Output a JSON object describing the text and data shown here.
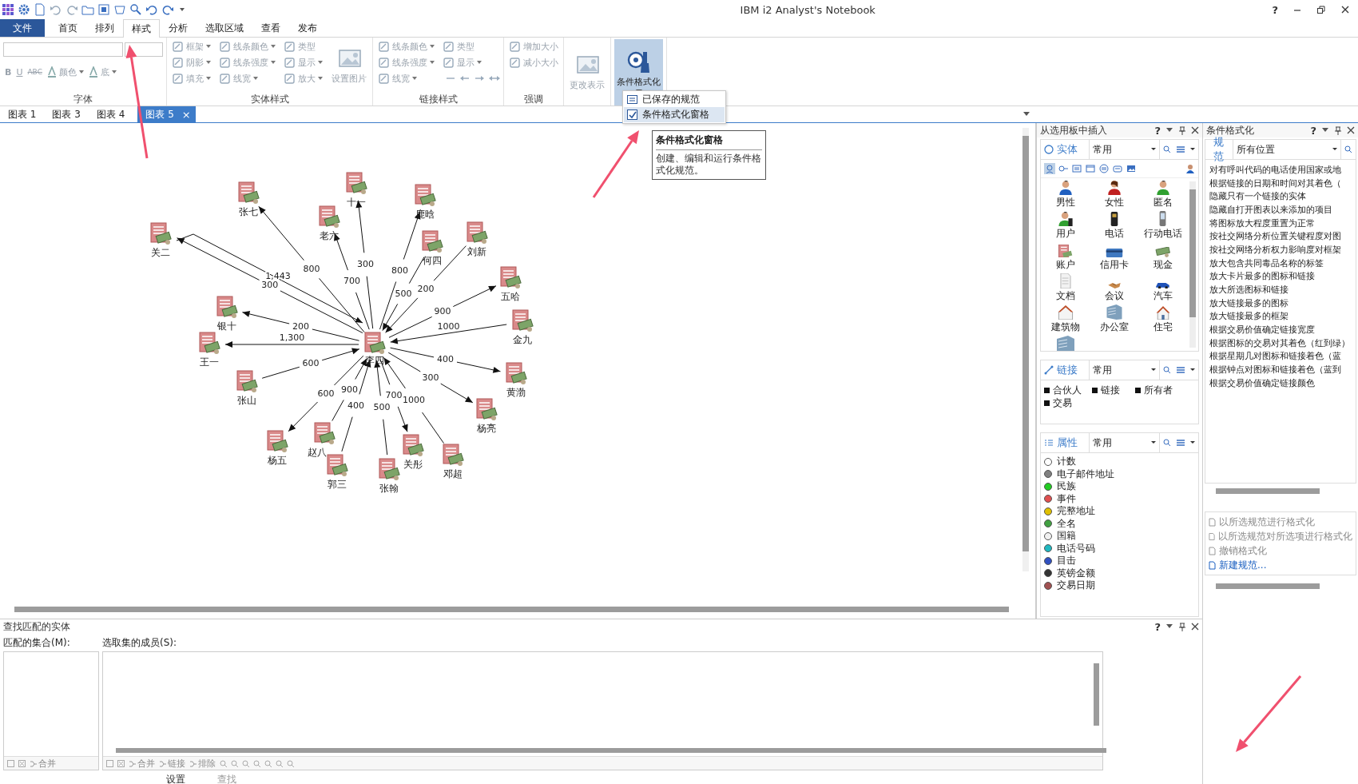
{
  "window": {
    "title": "IBM i2 Analyst's Notebook",
    "help": "?"
  },
  "ribbon_tabs": [
    {
      "label": "文件",
      "kind": "file",
      "selected": false
    },
    {
      "label": "首页",
      "kind": "tab",
      "selected": false
    },
    {
      "label": "排列",
      "kind": "tab",
      "selected": false
    },
    {
      "label": "样式",
      "kind": "tab",
      "selected": true
    },
    {
      "label": "分析",
      "kind": "tab",
      "selected": false
    },
    {
      "label": "选取区域",
      "kind": "tab",
      "selected": false
    },
    {
      "label": "查看",
      "kind": "tab",
      "selected": false
    },
    {
      "label": "发布",
      "kind": "tab",
      "selected": false
    }
  ],
  "ribbon_groups": [
    {
      "kind": "font",
      "title": "字体",
      "disabled": true,
      "items": [
        {
          "label": "B",
          "kind": "bold"
        },
        {
          "label": "U",
          "kind": "underline"
        },
        {
          "label": "ABC",
          "kind": "strike"
        },
        {
          "label": "颜色",
          "kind": "color"
        },
        {
          "label": "底",
          "kind": "color"
        }
      ]
    },
    {
      "kind": "columns",
      "title": "实体样式",
      "disabled": true,
      "columns": [
        [
          {
            "label": "框架",
            "dropdown": true
          },
          {
            "label": "阴影",
            "dropdown": true
          },
          {
            "label": "填充",
            "dropdown": true
          }
        ],
        [
          {
            "label": "线条颜色",
            "dropdown": true
          },
          {
            "label": "线条强度",
            "dropdown": true
          },
          {
            "label": "线宽",
            "dropdown": true
          }
        ],
        [
          {
            "label": "类型",
            "dropdown": false
          },
          {
            "label": "显示",
            "dropdown": true
          },
          {
            "label": "放大",
            "dropdown": true
          }
        ]
      ],
      "large": [
        {
          "label": "设置图片",
          "pressed": false
        }
      ]
    },
    {
      "kind": "columns",
      "title": "链接样式",
      "disabled": true,
      "columns": [
        [
          {
            "label": "线条颜色",
            "dropdown": true
          },
          {
            "label": "线条强度",
            "dropdown": true
          },
          {
            "label": "线宽",
            "dropdown": true
          }
        ],
        [
          {
            "label": "类型",
            "dropdown": false
          },
          {
            "label": "显示",
            "dropdown": true
          },
          {
            "kind": "arrows"
          }
        ]
      ]
    },
    {
      "kind": "columns",
      "title": "强调",
      "disabled": true,
      "columns": [
        [
          {
            "label": "增加大小",
            "dropdown": false
          },
          {
            "label": "减小大小",
            "dropdown": false
          }
        ]
      ]
    },
    {
      "kind": "columns",
      "disabled": true,
      "large": [
        {
          "label": "更改表示",
          "pressed": false
        }
      ]
    },
    {
      "kind": "columns",
      "disabled": false,
      "large": [
        {
          "label": "条件格式化",
          "pressed": true,
          "dropdown": true
        }
      ]
    }
  ],
  "doc_tabs": [
    {
      "label": "图表 1",
      "selected": false
    },
    {
      "label": "图表 3",
      "selected": false
    },
    {
      "label": "图表 4",
      "selected": false
    },
    {
      "label": "图表 5",
      "selected": true,
      "close": "×"
    }
  ],
  "dropdown_menu": {
    "items": [
      {
        "label": "已保存的规范",
        "kind": "list",
        "selected": false
      },
      {
        "label": "条件格式化窗格",
        "kind": "check",
        "selected": true
      }
    ]
  },
  "tooltip": {
    "title": "条件格式化窗格",
    "text": "创建、编辑和运行条件格式化规范。"
  },
  "chart": {
    "center": {
      "label": "李四"
    },
    "nodes": [
      {
        "label": "张七",
        "links": [
          {
            "label": "800",
            "outgoing": true,
            "kind": "straight"
          }
        ]
      },
      {
        "label": "十一",
        "links": [
          {
            "label": "300",
            "outgoing": true,
            "kind": "straight"
          }
        ]
      },
      {
        "label": "鹿晗",
        "links": [
          {
            "label": "800",
            "outgoing": true,
            "kind": "straight"
          }
        ]
      },
      {
        "label": "关二",
        "links": [
          {
            "label": "1,443",
            "outgoing": false,
            "kind": "elbow"
          },
          {
            "label": "300",
            "outgoing": true,
            "kind": "straight"
          }
        ]
      },
      {
        "label": "老六",
        "links": [
          {
            "label": "700",
            "outgoing": true,
            "kind": "straight"
          }
        ]
      },
      {
        "label": "何四",
        "links": [
          {
            "label": "500",
            "outgoing": false,
            "kind": "straight"
          }
        ]
      },
      {
        "label": "刘新",
        "links": [
          {
            "label": "200",
            "outgoing": false,
            "kind": "straight"
          }
        ]
      },
      {
        "label": "五哈",
        "links": [
          {
            "label": "900",
            "outgoing": true,
            "kind": "straight"
          }
        ]
      },
      {
        "label": "银十",
        "links": [
          {
            "label": "200",
            "outgoing": true,
            "kind": "straight"
          }
        ]
      },
      {
        "label": "王一",
        "links": [
          {
            "label": "1,300",
            "outgoing": true,
            "kind": "straight"
          }
        ]
      },
      {
        "label": "金九",
        "links": [
          {
            "label": "1000",
            "outgoing": false,
            "kind": "straight"
          }
        ]
      },
      {
        "label": "张山",
        "links": [
          {
            "label": "600",
            "outgoing": false,
            "kind": "straight"
          }
        ]
      },
      {
        "label": "黄渤",
        "links": [
          {
            "label": "400",
            "outgoing": true,
            "kind": "straight"
          }
        ]
      },
      {
        "label": "杨亮",
        "links": [
          {
            "label": "300",
            "outgoing": true,
            "kind": "straight"
          }
        ]
      },
      {
        "label": "杨五",
        "links": [
          {
            "label": "600",
            "outgoing": true,
            "kind": "straight"
          }
        ]
      },
      {
        "label": "赵八",
        "links": [
          {
            "label": "900",
            "outgoing": false,
            "kind": "straight"
          }
        ]
      },
      {
        "label": "郭三",
        "links": [
          {
            "label": "400",
            "outgoing": false,
            "kind": "straight"
          }
        ]
      },
      {
        "label": "张翰",
        "links": [
          {
            "label": "500",
            "outgoing": false,
            "kind": "straight"
          }
        ]
      },
      {
        "label": "关彤",
        "links": [
          {
            "label": "700",
            "outgoing": true,
            "kind": "straight"
          }
        ]
      },
      {
        "label": "邓超",
        "links": [
          {
            "label": "1000",
            "outgoing": false,
            "kind": "straight"
          }
        ]
      }
    ]
  },
  "insert_panel": {
    "title": "从选用板中插入",
    "help": "?",
    "entity_section": {
      "tab": "实体",
      "combo": "常用"
    },
    "entity_views": [
      {
        "kind": "person",
        "selected": true
      },
      {
        "kind": "link",
        "selected": false
      },
      {
        "kind": "card",
        "selected": false
      },
      {
        "kind": "window",
        "selected": false
      },
      {
        "kind": "list",
        "selected": false
      },
      {
        "kind": "label",
        "selected": false
      },
      {
        "kind": "picture",
        "selected": false
      }
    ],
    "entities": [
      {
        "label": "男性",
        "kind": "male"
      },
      {
        "label": "女性",
        "kind": "female"
      },
      {
        "label": "匿名",
        "kind": "anonymous"
      },
      {
        "label": "用户",
        "kind": "user"
      },
      {
        "label": "电话",
        "kind": "phone"
      },
      {
        "label": "行动电话",
        "kind": "mobile"
      },
      {
        "label": "账户",
        "kind": "account"
      },
      {
        "label": "信用卡",
        "kind": "card"
      },
      {
        "label": "现金",
        "kind": "cash"
      },
      {
        "label": "文档",
        "kind": "document"
      },
      {
        "label": "会议",
        "kind": "meeting"
      },
      {
        "label": "汽车",
        "kind": "car"
      },
      {
        "label": "建筑物",
        "kind": "building"
      },
      {
        "label": "办公室",
        "kind": "office"
      },
      {
        "label": "住宅",
        "kind": "house"
      },
      {
        "kind": "office"
      }
    ],
    "link_section": {
      "tab": "链接",
      "combo": "常用"
    },
    "links": [
      "合伙人",
      "链接",
      "所有者",
      "交易"
    ],
    "attribute_section": {
      "tab": "属性",
      "combo": "常用"
    },
    "attributes": [
      {
        "label": "计数",
        "color": "#ffffff"
      },
      {
        "label": "电子邮件地址",
        "color": "#808080"
      },
      {
        "label": "民族",
        "color": "#22cc22"
      },
      {
        "label": "事件",
        "color": "#e05050"
      },
      {
        "label": "完整地址",
        "color": "#e0c000"
      },
      {
        "label": "全名",
        "color": "#40a040"
      },
      {
        "label": "国籍",
        "color": "#f0f0f0"
      },
      {
        "label": "电话号码",
        "color": "#20b8c0"
      },
      {
        "label": "目击",
        "color": "#3050c0"
      },
      {
        "label": "英镑金额",
        "color": "#333333"
      },
      {
        "label": "交易日期",
        "color": "#a05050"
      }
    ]
  },
  "conditional_panel": {
    "title": "条件格式化",
    "help": "?",
    "tab": "规范",
    "location": "所有位置",
    "specs": [
      "对有呼叫代码的电话使用国家或地",
      "根据链接的日期和时间对其着色（",
      "隐藏只有一个链接的实体",
      "隐藏自打开图表以来添加的项目",
      "将图标放大程度重置为正常",
      "按社交网络分析位置关键程度对图",
      "按社交网络分析权力影响度对框架",
      "放大包含共同毒品名称的标签",
      "放大卡片最多的图标和链接",
      "放大所选图标和链接",
      "放大链接最多的图标",
      "放大链接最多的框架",
      "根据交易价值确定链接宽度",
      "根据图标的交易对其着色（红到绿）",
      "根据星期几对图标和链接着色（蓝",
      "根据钟点对图标和链接着色（蓝到",
      "根据交易价值确定链接颜色"
    ],
    "actions": [
      {
        "label": "以所选规范进行格式化",
        "disabled": true
      },
      {
        "label": "以所选规范对所选项进行格式化",
        "disabled": true
      },
      {
        "label": "撤销格式化",
        "disabled": true
      },
      {
        "label": "新建规范...",
        "disabled": false
      }
    ]
  },
  "find_panel": {
    "title": "查找匹配的实体",
    "help": "?",
    "sets_label": "匹配的集合(M):",
    "members_label": "选取集的成员(S):",
    "left_tools": [
      "合并"
    ],
    "right_tools": [
      "合并",
      "链接",
      "排除"
    ]
  },
  "bottom_tabs": [
    {
      "label": "设置",
      "selected": true
    },
    {
      "label": "查找",
      "selected": false
    }
  ]
}
